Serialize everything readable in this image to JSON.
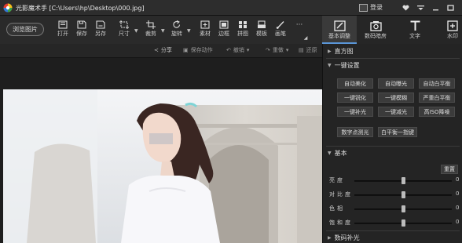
{
  "window": {
    "title": "光影魔术手 [C:\\Users\\hp\\Desktop\\000.jpg]",
    "login_label": "登录",
    "accent": "#5a96d8"
  },
  "toolbar": {
    "browse_label": "浏览图片",
    "tools": [
      "打开",
      "保存",
      "另存",
      "尺寸",
      "裁剪",
      "旋转",
      "素材",
      "边框",
      "拼图",
      "模板",
      "画笔"
    ],
    "more_label": "···"
  },
  "right_tabs": [
    "基本调整",
    "数码暗房",
    "文字",
    "水印"
  ],
  "undo_bar": {
    "share": "分享",
    "save_action": "保存动作",
    "undo": "撤销",
    "redo": "重做",
    "restore": "还原"
  },
  "panel": {
    "histogram": "直方图",
    "one_click": "一键设置",
    "one_click_buttons": [
      "自动美化",
      "自动曝光",
      "自动白平衡",
      "一键锐化",
      "一键模糊",
      "严重白平衡",
      "一键补光",
      "一键减光",
      "高ISO降噪"
    ],
    "extra_buttons": [
      "数字点测光",
      "白平衡一指键"
    ],
    "basic": "基本",
    "reset": "重置",
    "sliders": [
      {
        "label": "亮度",
        "value": 0,
        "position": 0.5
      },
      {
        "label": "对比度",
        "value": 0,
        "position": 0.5
      },
      {
        "label": "色相",
        "value": 0,
        "position": 0.5
      },
      {
        "label": "饱和度",
        "value": 0,
        "position": 0.5
      }
    ],
    "digital_fill": "数码补光"
  }
}
